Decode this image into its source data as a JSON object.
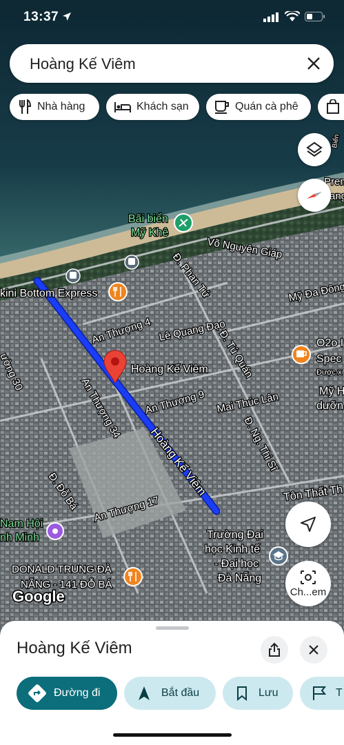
{
  "status_bar": {
    "time": "13:37"
  },
  "search": {
    "query": "Hoàng Kế Viêm"
  },
  "chips": [
    {
      "label": "Nhà hàng",
      "icon": "restaurant-icon"
    },
    {
      "label": "Khách sạn",
      "icon": "hotel-icon"
    },
    {
      "label": "Quán cà phê",
      "icon": "cafe-icon"
    }
  ],
  "map": {
    "labels": {
      "beach": "Bãi biển",
      "beach2": "Mỹ Khê",
      "vo_nguyen_giap": "Võ Nguyên Giáp",
      "phan_tu": "Đ. Phan Tứ",
      "my_da_dong": "Mỹ Đa Đông",
      "bikini": "kini Bottom Express",
      "an_thuong_4": "An Thượng 4",
      "le_quang_dao": "Lê Quang Đạo",
      "tu_quan": "Đ. Tú Quán",
      "o2o_1": "O2o I",
      "o2o_2": "Spec",
      "o2o_3": "Được x",
      "duong_30": "ường 30",
      "pin_label": "Hoàng Kế Viêm",
      "an_thuong_34": "An Thượng 34",
      "an_thuong_9": "An Thượng 9",
      "mai_thuc_lan": "Mai Thúc Lân",
      "my_h1": "Mỹ H",
      "my_h2": "dưỡn",
      "ng_thi_si": "Đ. Ng. Thi Sĩ",
      "hoang_ke_viem_road": "Hoàng Kế Viêm",
      "do_ba": "Đ. Đỗ Bá",
      "an_thuong_17": "An Thượng 17",
      "ton_that": "Tôn Thất Th",
      "nam_hoi": "Nam Hội",
      "nh_minh": "nh Minh",
      "truong_1": "Trường Đại",
      "truong_2": "học Kinh tế",
      "truong_3": "- Đại học",
      "truong_4": "Đà Nẵng",
      "donald_1": "DONALD TRUNG ĐÀ",
      "donald_2": "NẴNG - 141 ĐỖ BÁ",
      "premier_1": "Premier",
      "premier_2": "ang",
      "bien": "Biển",
      "chem_label": "Ch...em",
      "google": "Google"
    },
    "route_color": "#1a3df5",
    "pin_color": "#ea4335"
  },
  "sheet": {
    "title": "Hoàng Kế Viêm",
    "actions": [
      {
        "label": "Đường đi",
        "icon": "directions-icon"
      },
      {
        "label": "Bắt đầu",
        "icon": "navigation-arrow-icon"
      },
      {
        "label": "Lưu",
        "icon": "bookmark-icon"
      },
      {
        "label": "T",
        "icon": "flag-icon"
      }
    ]
  }
}
